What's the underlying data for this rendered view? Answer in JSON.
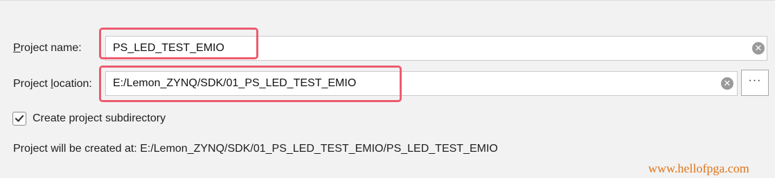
{
  "project_name": {
    "label_underlined": "P",
    "label_rest": "roject name:",
    "value": "PS_LED_TEST_EMIO"
  },
  "project_location": {
    "label_before": "Project ",
    "label_underlined": "l",
    "label_after": "ocation:",
    "value": "E:/Lemon_ZYNQ/SDK/01_PS_LED_TEST_EMIO",
    "browse_label": "···"
  },
  "subdirectory": {
    "label": "Create project subdirectory",
    "checked": true
  },
  "created_at": {
    "label": "Project will be created at:",
    "path": "E:/Lemon_ZYNQ/SDK/01_PS_LED_TEST_EMIO/PS_LED_TEST_EMIO"
  },
  "icons": {
    "clear": "clear-icon",
    "check": "checkmark-icon",
    "browse": "more-icon"
  },
  "colors": {
    "highlight": "#ec5a6e",
    "watermark": "#e0751a"
  },
  "watermark": "www.hellofpga.com"
}
